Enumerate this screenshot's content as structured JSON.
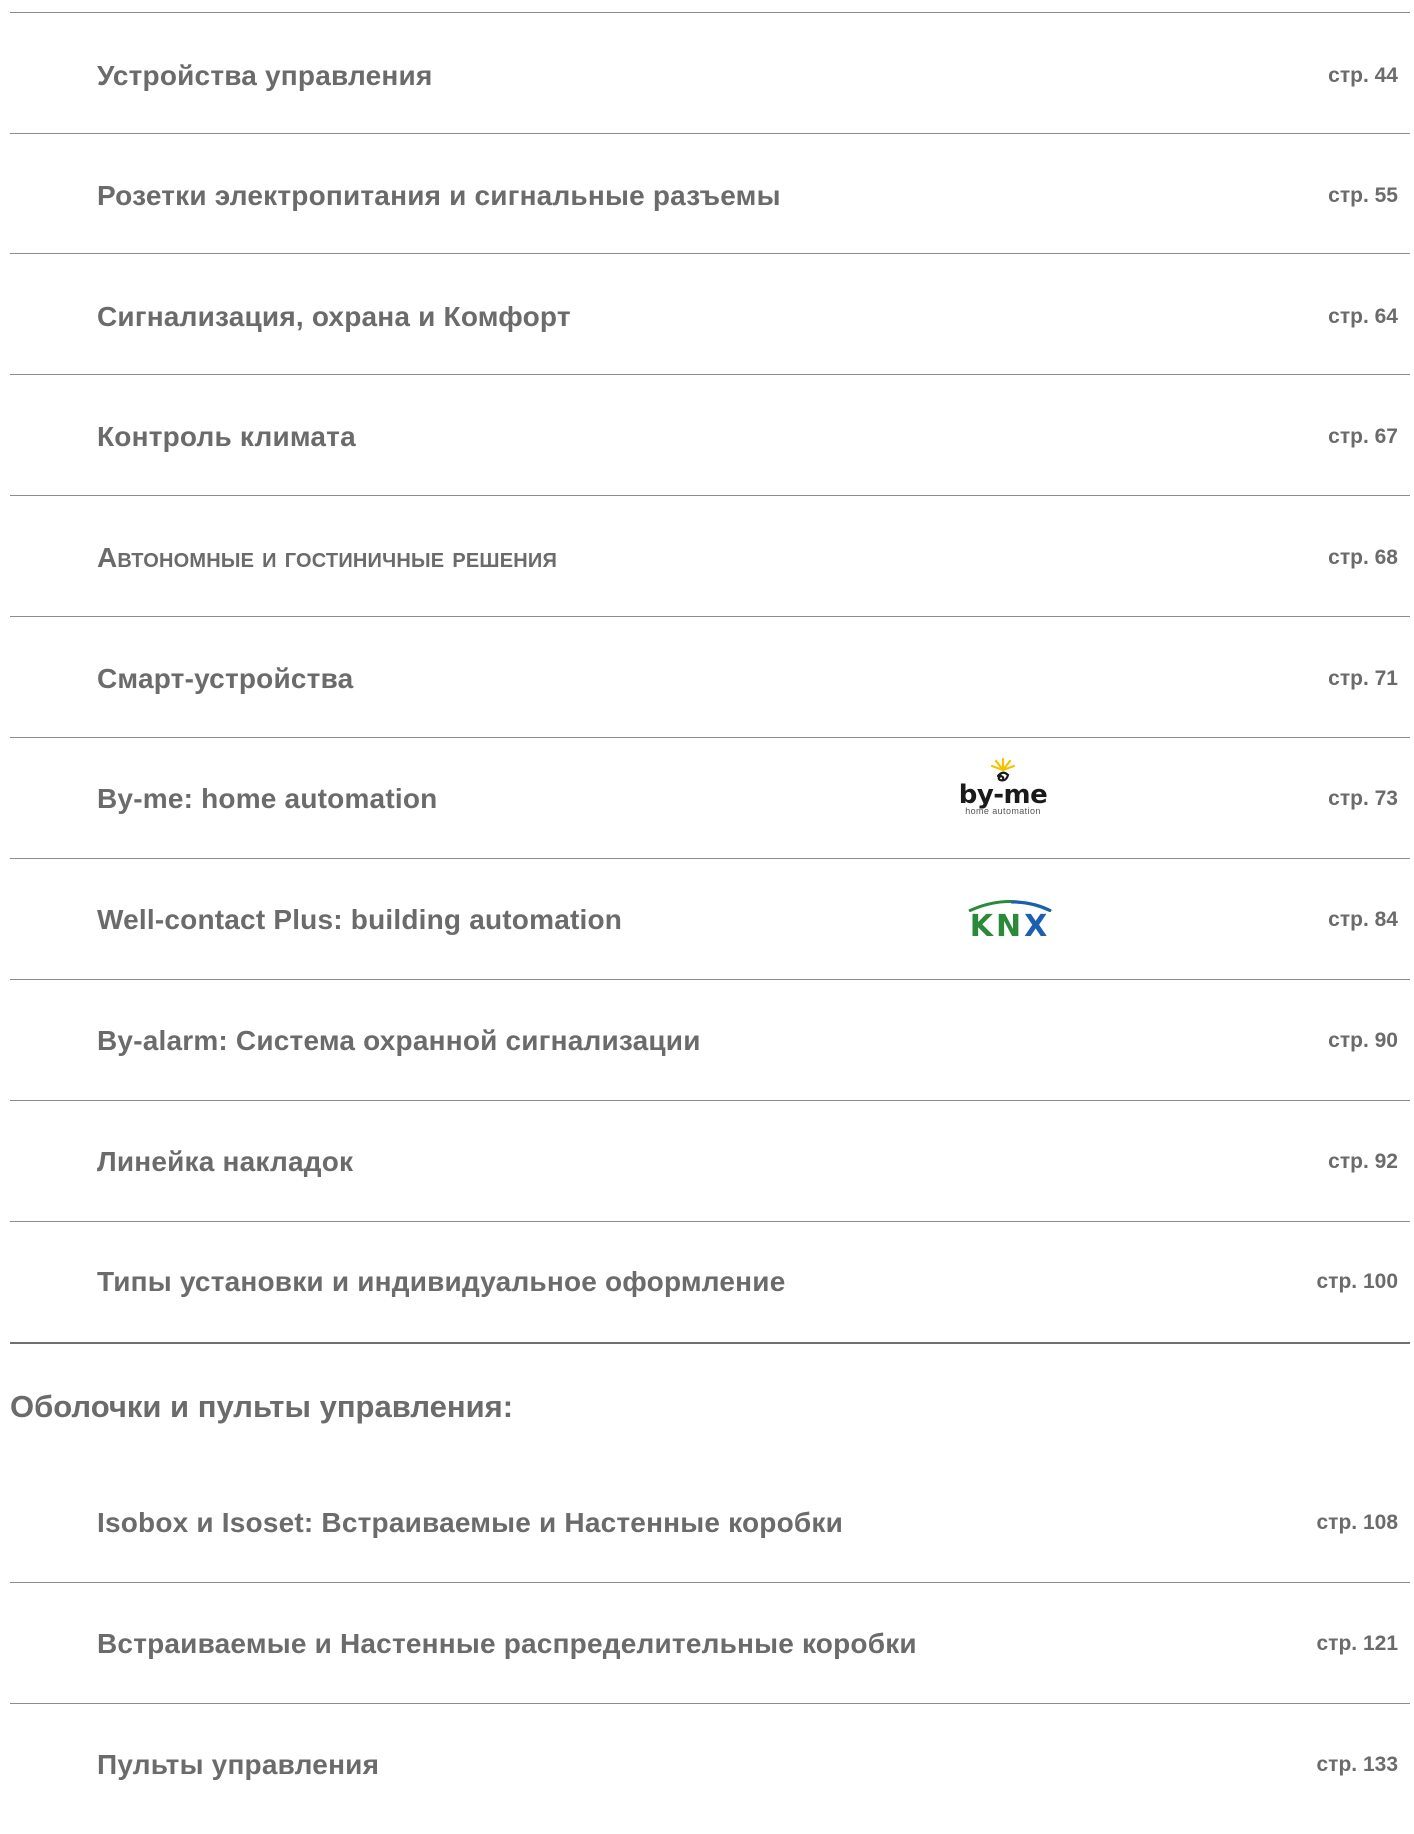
{
  "entries_top": [
    {
      "title": "Устройства управления",
      "page": "стр. 44"
    },
    {
      "title": "Розетки электропитания и сигнальные разъемы",
      "page": "стр. 55"
    },
    {
      "title": "Сигнализация, охрана и Комфорт",
      "page": "стр. 64"
    },
    {
      "title": "Контроль климата",
      "page": "стр. 67"
    },
    {
      "title": "Автономные и гостиничные решения",
      "page": "стр. 68"
    },
    {
      "title": "Смарт-устройства",
      "page": "стр. 71"
    },
    {
      "title": "By-me: home automation",
      "page": "стр. 73"
    },
    {
      "title": "Well-contact Plus: building automation",
      "page": "стр. 84"
    },
    {
      "title": "By-alarm: Система охранной сигнализации",
      "page": "стр. 90"
    },
    {
      "title": "Линейка накладок",
      "page": "стр. 92"
    },
    {
      "title": "Типы установки и индивидуальное оформление",
      "page": "стр. 100"
    }
  ],
  "section_heading": "Оболочки и пульты управления:",
  "entries_bottom": [
    {
      "title": "Isobox и Isoset: Встраиваемые и Настенные коробки",
      "page": "стр. 108"
    },
    {
      "title": "Встраиваемые и Настенные распределительные коробки",
      "page": "стр. 121"
    },
    {
      "title": "Пульты управления",
      "page": "стр. 133"
    }
  ],
  "logos": {
    "byme": {
      "main": "by-me",
      "sub": "home automation",
      "icon": "byme-logo-icon"
    },
    "knx": {
      "main_left": "KN",
      "main_right": "X",
      "icon": "knx-logo-icon",
      "colors": {
        "green": "#2a8a3a",
        "blue": "#1a5fb0"
      }
    }
  },
  "colors": {
    "text": "#6b6b6b",
    "rule": "#8d8d8d"
  }
}
